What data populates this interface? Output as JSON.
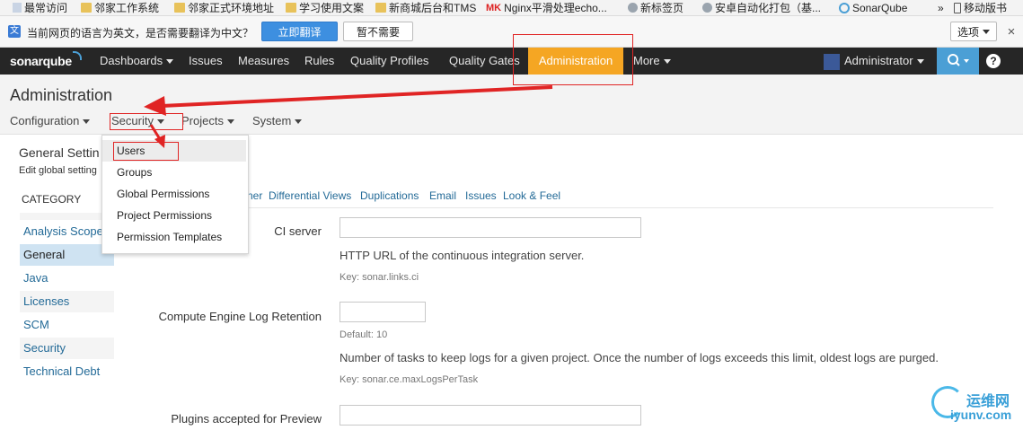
{
  "browser": {
    "bookmarks": [
      {
        "label": "最常访问",
        "icon": "doc-icon"
      },
      {
        "label": "邻家工作系统",
        "icon": "folder-icon"
      },
      {
        "label": "邻家正式环境地址",
        "icon": "folder-icon"
      },
      {
        "label": "学习使用文案",
        "icon": "folder-icon"
      },
      {
        "label": "新商城后台和TMS",
        "icon": "folder-icon"
      },
      {
        "label": "Nginx平滑处理echo...",
        "icon": "mk-icon",
        "icon_text": "MK"
      },
      {
        "label": "新标签页",
        "icon": "globe-icon"
      },
      {
        "label": "安卓自动化打包（基...",
        "icon": "globe-icon"
      },
      {
        "label": "SonarQube",
        "icon": "sonar-icon"
      },
      {
        "label": "»",
        "icon": ""
      },
      {
        "label": "移动版书",
        "icon": "phone-icon"
      }
    ],
    "translate_bar": {
      "message": "当前网页的语言为英文，是否需要翻译为中文？",
      "translate_button": "立即翻译",
      "decline_button": "暂不需要",
      "options_button": "选项",
      "close": "×"
    }
  },
  "nav": {
    "logo": "sonarqube",
    "items": [
      "Dashboards",
      "Issues",
      "Measures",
      "Rules",
      "Quality Profiles",
      "Quality Gates",
      "Administration",
      "More"
    ],
    "user": "Administrator",
    "help": "?"
  },
  "admin": {
    "title": "Administration",
    "menu": [
      "Configuration",
      "Security",
      "Projects",
      "System"
    ]
  },
  "dropdown": {
    "items": [
      "Users",
      "Groups",
      "Global Permissions",
      "Project Permissions",
      "Permission Templates"
    ]
  },
  "sidebar": {
    "title": "General Settin",
    "subtitle": "Edit global setting",
    "category_header": "CATEGORY",
    "categories": [
      "Analysis Scope",
      "General",
      "Java",
      "Licenses",
      "SCM",
      "Security",
      "Technical Debt"
    ],
    "selected": "General"
  },
  "content": {
    "tabs_fragment": "ner",
    "tabs": [
      "Differential Views",
      "Duplications",
      "Email",
      "Issues",
      "Look & Feel"
    ],
    "fields": [
      {
        "label": "CI server",
        "value": "",
        "help": "HTTP URL of the continuous integration server.",
        "key": "Key: sonar.links.ci"
      },
      {
        "label": "Compute Engine Log Retention",
        "value": "",
        "default": "Default: 10",
        "help": "Number of tasks to keep logs for a given project. Once the number of logs exceeds this limit, oldest logs are purged.",
        "key": "Key: sonar.ce.maxLogsPerTask"
      },
      {
        "label": "Plugins accepted for Preview",
        "value": ""
      }
    ]
  },
  "watermark": {
    "cn": "运维网",
    "url": "iyunv.com"
  },
  "colors": {
    "nav_bg": "#262626",
    "active_tab": "#f5a623",
    "search_bg": "#4b9fd5",
    "link": "#236a97",
    "annotation": "#e02424"
  }
}
